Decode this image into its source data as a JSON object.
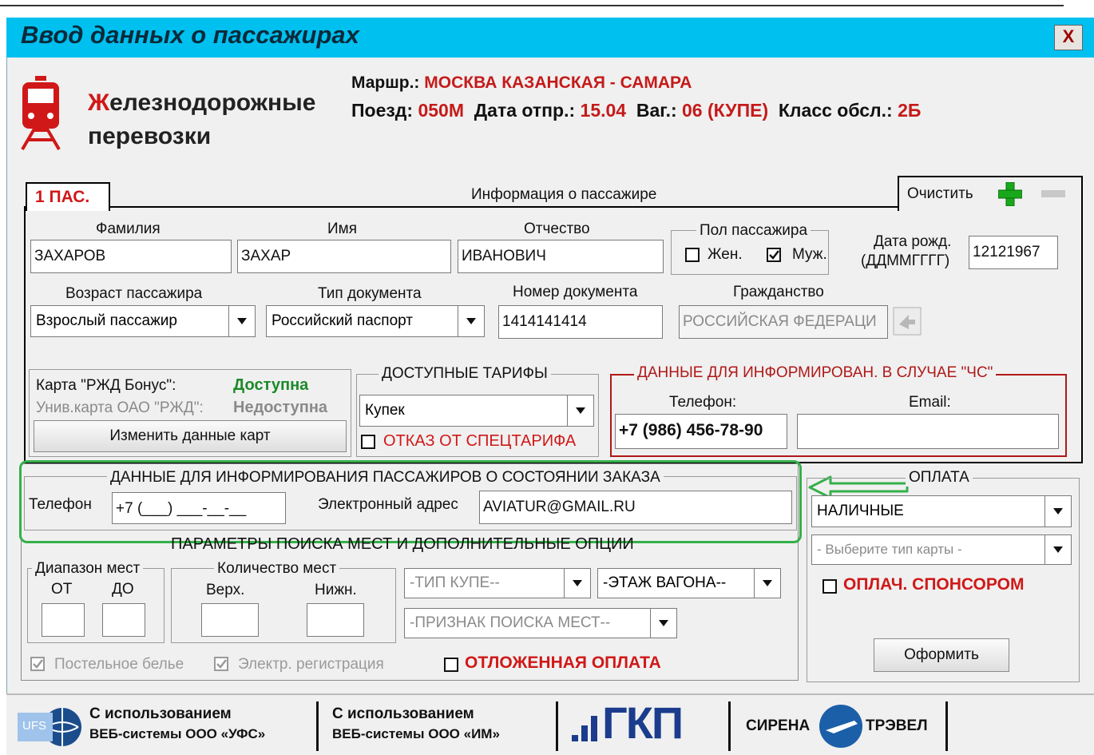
{
  "window": {
    "title": "Ввод данных о пассажирах",
    "close_label": "X"
  },
  "logo": {
    "first_letter": "Ж",
    "line1_rest": "елезнодорожные",
    "line2": "перевозки"
  },
  "route": {
    "route_label": "Маршр.:",
    "route_value": "МОСКВА КАЗАНСКАЯ - САМАРА",
    "train_label": "Поезд:",
    "train_value": "050М",
    "date_label": "Дата отпр.:",
    "date_value": "15.04",
    "car_label": "Ваг.:",
    "car_value": "06 (КУПЕ)",
    "class_label": "Класс обсл.:",
    "class_value": "2Б"
  },
  "tabs": {
    "passenger_tab": "1 ПАС.",
    "info_title": "Информация о пассажире",
    "clear_label": "Очистить"
  },
  "passenger": {
    "surname_label": "Фамилия",
    "surname_value": "ЗАХАРОВ",
    "name_label": "Имя",
    "name_value": "ЗАХАР",
    "patronymic_label": "Отчество",
    "patronymic_value": "ИВАНОВИЧ",
    "gender_group": "Пол пассажира",
    "female_label": "Жен.",
    "male_label": "Муж.",
    "birth_label_1": "Дата рожд.",
    "birth_label_2": "(ДДММГГГГ)",
    "birth_value": "12121967",
    "age_label": "Возраст пассажира",
    "age_value": "Взрослый пассажир",
    "doctype_label": "Тип документа",
    "doctype_value": "Российский паспорт",
    "docnum_label": "Номер документа",
    "docnum_value": "1414141414",
    "citizenship_label": "Гражданство",
    "citizenship_value": "РОССИЙСКАЯ ФЕДЕРАЦИ"
  },
  "cards": {
    "bonus_label": "Карта \"РЖД Бонус\":",
    "bonus_status": "Доступна",
    "univ_label": "Унив.карта ОАО \"РЖД\":",
    "univ_status": "Недоступна",
    "change_button": "Изменить данные карт"
  },
  "tariffs": {
    "group": "ДОСТУПНЫЕ ТАРИФЫ",
    "selected": "Купек",
    "refusal_label": "ОТКАЗ ОТ СПЕЦТАРИФА"
  },
  "emergency": {
    "group": "ДАННЫЕ ДЛЯ ИНФОРМИРОВАН. В СЛУЧАЕ \"ЧС\"",
    "phone_label": "Телефон:",
    "phone_value": "+7 (986) 456-78-90",
    "email_label": "Email:",
    "email_value": ""
  },
  "notify": {
    "group": "ДАННЫЕ ДЛЯ ИНФОРМИРОВАНИЯ ПАССАЖИРОВ О СОСТОЯНИИ ЗАКАЗА",
    "phone_label": "Телефон",
    "phone_value": "+7 (___) ___-__-__",
    "email_label": "Электронный адрес",
    "email_value": "AVIATUR@GMAIL.RU"
  },
  "search": {
    "group": "ПАРАМЕТРЫ ПОИСКА МЕСТ И ДОПОЛНИТЕЛЬНЫЕ ОПЦИИ",
    "range_group": "Диапазон мест",
    "from_label": "ОТ",
    "to_label": "ДО",
    "count_group": "Количество мест",
    "upper_label": "Верх.",
    "lower_label": "Нижн.",
    "coupe_type": "-ТИП КУПЕ--",
    "car_floor": "-ЭТАЖ ВАГОНА--",
    "seat_feature": "-ПРИЗНАК ПОИСКА МЕСТ--",
    "bedding_label": "Постельное белье",
    "ereg_label": "Электр. регистрация",
    "deferred_label": "ОТЛОЖЕННАЯ ОПЛАТА"
  },
  "payment": {
    "group": "ОПЛАТА",
    "method": "НАЛИЧНЫЕ",
    "card_type": "- Выберите тип карты -",
    "sponsor_label": "ОПЛАЧ. СПОНСОРОМ",
    "submit_button": "Оформить"
  },
  "footer": {
    "ufs_line1": "С использованием",
    "ufs_line2": "ВЕБ-системы ООО «УФС»",
    "im_line1": "С использованием",
    "im_line2": "ВЕБ-системы ООО «ИМ»",
    "gkp": "ГКП",
    "siren_left": "СИРЕНА",
    "siren_right": "ТРЭВЕЛ",
    "ufs_badge": "UFS"
  },
  "colors": {
    "title_bar": "#00c0f0",
    "accent_red": "#d01818",
    "green_status": "#1d8a2a",
    "highlight_green": "#34b04a"
  }
}
